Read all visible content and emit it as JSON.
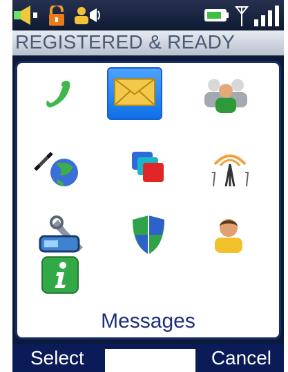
{
  "status_bar": {
    "icons": [
      "speaker-icon",
      "unlock-icon",
      "contact-call-icon",
      "battery-icon",
      "signal-icon"
    ]
  },
  "status_title": "REGISTERED & READY",
  "menu": {
    "selected_label": "Messages",
    "items": [
      {
        "icon": "phone-icon",
        "selected": false
      },
      {
        "icon": "envelope-icon",
        "selected": true
      },
      {
        "icon": "contacts-icon",
        "selected": false
      },
      {
        "icon": "network-globe-icon",
        "selected": false
      },
      {
        "icon": "stacked-windows-icon",
        "selected": false
      },
      {
        "icon": "radio-antenna-icon",
        "selected": false
      },
      {
        "icon": "settings-tools-icon",
        "selected": false
      },
      {
        "icon": "security-shield-icon",
        "selected": false
      },
      {
        "icon": "user-profile-icon",
        "selected": false
      },
      {
        "icon": "info-icon",
        "selected": false
      }
    ]
  },
  "softkeys": {
    "left": "Select",
    "right": "Cancel"
  },
  "colors": {
    "accent": "#0d6fe6",
    "softbar": "#0a1b57",
    "label": "#1d2f7a"
  }
}
